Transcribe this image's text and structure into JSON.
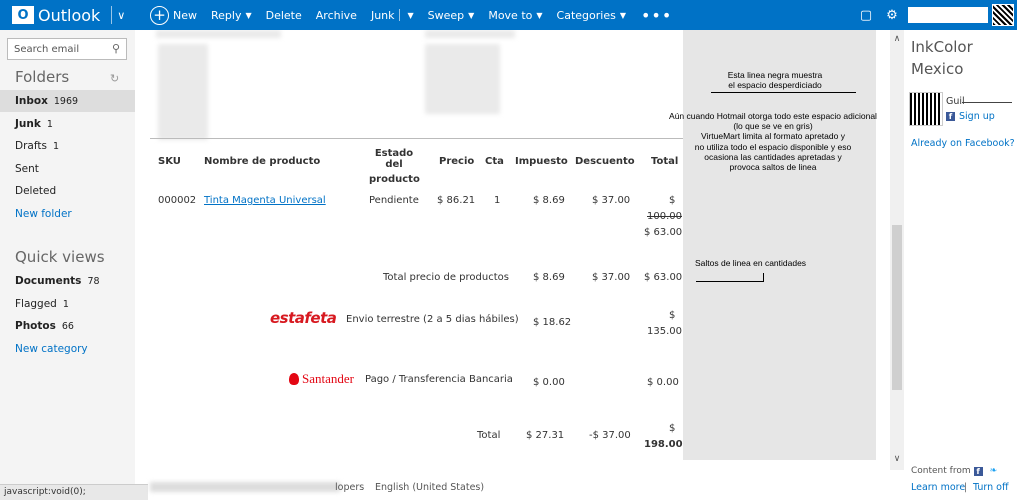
{
  "app": {
    "name": "Outlook"
  },
  "toolbar": {
    "new": "New",
    "reply": "Reply",
    "delete": "Delete",
    "archive": "Archive",
    "junk": "Junk",
    "sweep": "Sweep",
    "move_to": "Move to",
    "categories": "Categories",
    "more": "•••"
  },
  "leftnav": {
    "search_placeholder": "Search email",
    "folders_heading": "Folders",
    "folders": [
      {
        "label": "Inbox",
        "count": "1969"
      },
      {
        "label": "Junk",
        "count": "1"
      },
      {
        "label": "Drafts",
        "count": "1"
      },
      {
        "label": "Sent",
        "count": ""
      },
      {
        "label": "Deleted",
        "count": ""
      }
    ],
    "new_folder": "New folder",
    "quick_views_heading": "Quick views",
    "quick_views": [
      {
        "label": "Documents",
        "count": "78"
      },
      {
        "label": "Flagged",
        "count": "1"
      },
      {
        "label": "Photos",
        "count": "66"
      }
    ],
    "new_category": "New category",
    "status_url": "javascript:void(0);"
  },
  "order": {
    "headers": {
      "sku": "SKU",
      "name": "Nombre de producto",
      "status_line1": "Estado del",
      "status_line2": "producto",
      "price": "Precio",
      "qty": "Cta",
      "tax": "Impuesto",
      "discount": "Descuento",
      "total": "Total"
    },
    "item": {
      "sku": "000002",
      "name": "Tinta Magenta Universal",
      "status": "Pendiente",
      "price": "$ 86.21",
      "qty": "1",
      "tax": "$ 8.69",
      "discount": "$ 37.00",
      "total_sign": "$",
      "total_old": "100.00",
      "total_new": "$ 63.00"
    },
    "subtotal": {
      "label": "Total precio de productos",
      "tax": "$ 8.69",
      "discount": "$ 37.00",
      "total": "$ 63.00"
    },
    "shipping": {
      "brand": "estafeta",
      "label": "Envio terrestre (2 a 5 dias hábiles)",
      "tax": "$ 18.62",
      "total_sign": "$",
      "total": "135.00"
    },
    "payment": {
      "brand": "Santander",
      "label": "Pago / Transferencia Bancaria",
      "tax": "$ 0.00",
      "total": "$ 0.00"
    },
    "grand": {
      "label": "Total",
      "tax": "$ 27.31",
      "discount": "-$ 37.00",
      "total_sign": "$",
      "total": "198.00"
    }
  },
  "notes": {
    "n1_line1": "Esta linea negra muestra",
    "n1_line2": "el espacio desperdiciado",
    "n2_line1": "Aún cuando Hotmail otorga todo este espacio adicional",
    "n2_line2": "(lo que se ve en gris)",
    "n2_line3": "VirtueMart limita al formato apretado y",
    "n2_line4": "no utiliza todo el espacio disponible y eso",
    "n2_line5": "ocasiona las cantidades apretadas y",
    "n2_line6": "provoca saltos de linea",
    "n3": "Saltos de linea en cantidades"
  },
  "right": {
    "title_line1": "InkColor",
    "title_line2": "Mexico",
    "name": "Guil",
    "signup": "Sign up",
    "already": "Already on Facebook?",
    "content_from": "Content from",
    "learn_more": "Learn more",
    "pipe": "|",
    "turn_off": "Turn off"
  },
  "footer": {
    "developers": "lopers",
    "language": "English (United States)"
  }
}
